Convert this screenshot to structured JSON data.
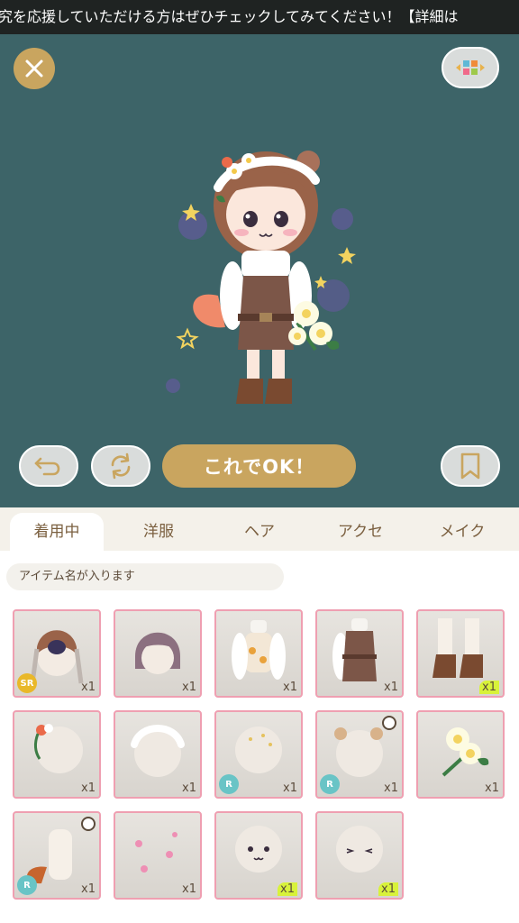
{
  "ticker": {
    "text": "究を応援していただける方はぜひチェックしてみてください！【詳細は"
  },
  "toolbar": {
    "close_icon": "close-icon",
    "switch_icon": "color-switch-icon"
  },
  "actions": {
    "undo_icon": "undo-icon",
    "refresh_icon": "refresh-icon",
    "ok_label": "これでOK！",
    "bookmark_icon": "bookmark-icon"
  },
  "tabs": [
    {
      "label": "着用中",
      "active": true
    },
    {
      "label": "洋服",
      "active": false
    },
    {
      "label": "ヘア",
      "active": false
    },
    {
      "label": "アクセ",
      "active": false
    },
    {
      "label": "メイク",
      "active": false
    }
  ],
  "search": {
    "placeholder": "アイテム名が入ります"
  },
  "items": [
    {
      "name": "brown-braid-hair",
      "count": "x1",
      "badge": "SR",
      "new": false
    },
    {
      "name": "purple-bob-hair",
      "count": "x1",
      "badge": "",
      "new": false
    },
    {
      "name": "white-floral-blouse",
      "count": "x1",
      "badge": "",
      "new": false
    },
    {
      "name": "brown-overall-shorts",
      "count": "x1",
      "badge": "",
      "new": false
    },
    {
      "name": "paw-boots",
      "count": "x1",
      "badge": "",
      "new": true
    },
    {
      "name": "flower-hair-accessory",
      "count": "x1",
      "badge": "",
      "new": false
    },
    {
      "name": "lace-headband",
      "count": "x1",
      "badge": "",
      "new": false
    },
    {
      "name": "sparkle-hair-glitter",
      "count": "x1",
      "badge": "R",
      "new": false
    },
    {
      "name": "bear-ears",
      "count": "x1",
      "badge": "R",
      "new": false
    },
    {
      "name": "white-flower-bouquet",
      "count": "x1",
      "badge": "",
      "new": false
    },
    {
      "name": "fox-tail",
      "count": "x1",
      "badge": "R",
      "new": false
    },
    {
      "name": "pink-aura-effect",
      "count": "x1",
      "badge": "",
      "new": false
    },
    {
      "name": "cat-mouth-face",
      "count": "x1",
      "badge": "",
      "new": true
    },
    {
      "name": "closed-eyes-face",
      "count": "x1",
      "badge": "",
      "new": true
    }
  ],
  "colors": {
    "stage_bg": "#3d6468",
    "accent_gold": "#c9a55f",
    "tab_text": "#7b6040",
    "item_border": "#ef9fb1",
    "new_badge": "#d8f23a",
    "sr_badge": "#e9b829",
    "r_badge": "#69c4c6"
  }
}
